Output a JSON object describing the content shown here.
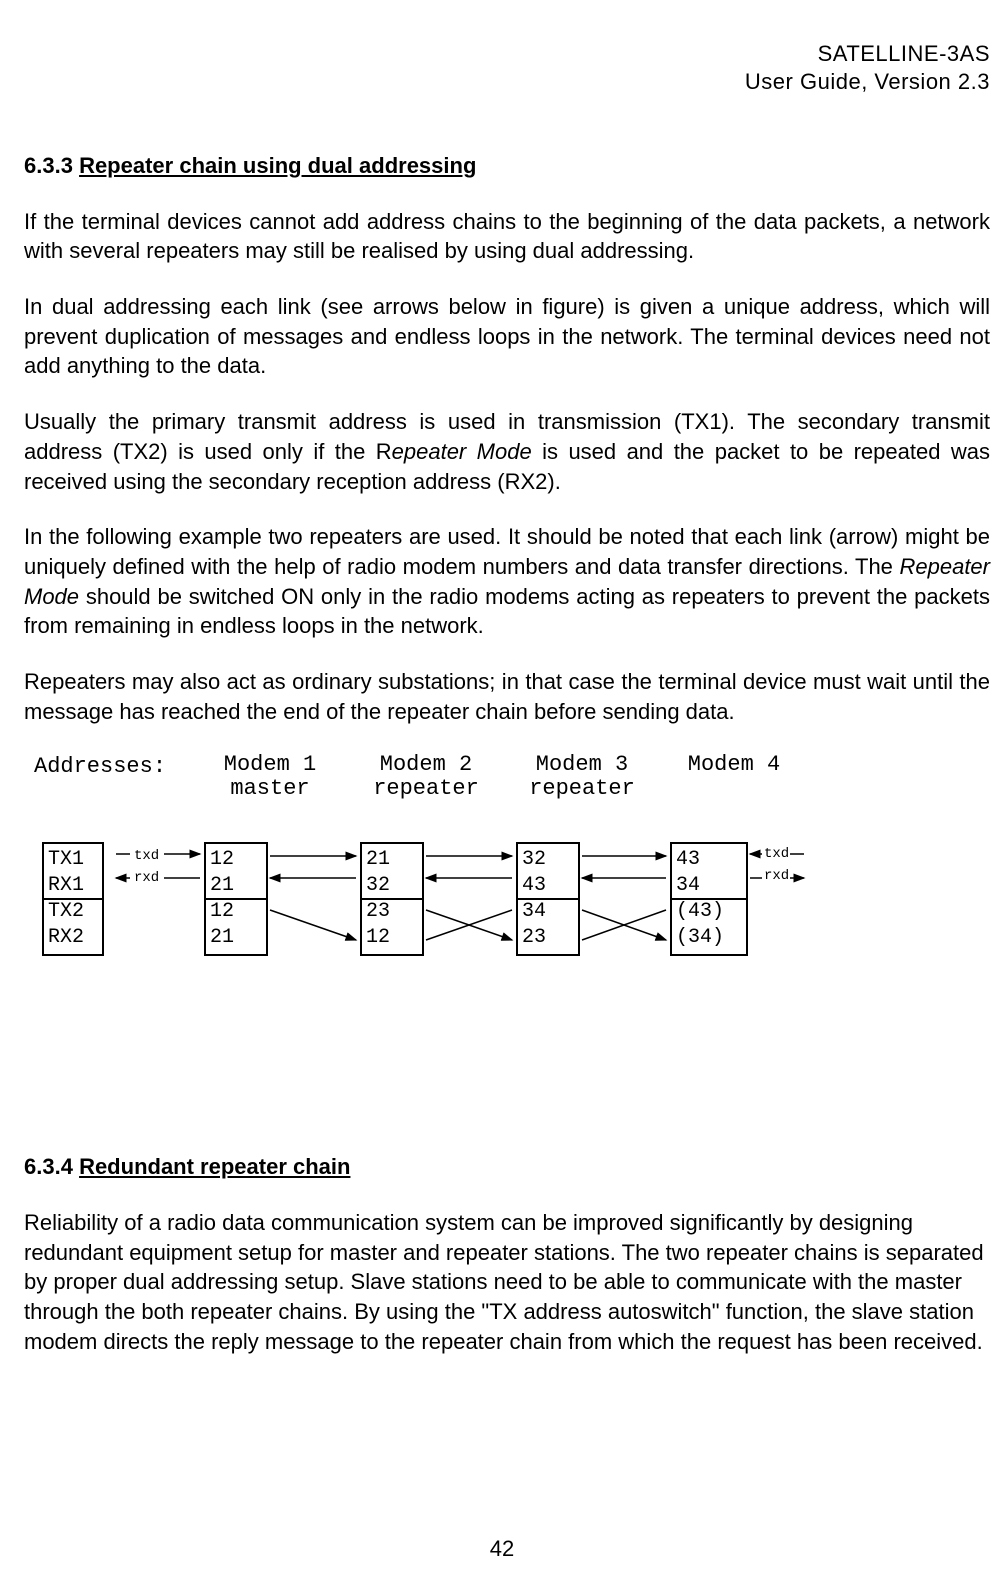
{
  "header": {
    "line1": "SATELLINE-3AS",
    "line2": "User Guide, Version 2.3"
  },
  "sections": [
    {
      "number": "6.3.3",
      "title": "Repeater chain using dual addressing",
      "paragraphs": [
        {
          "type": "plain",
          "text": "If the terminal devices cannot add address chains to the beginning of the data packets, a network with several repeaters may still be realised by using dual addressing."
        },
        {
          "type": "plain",
          "text": "In dual addressing each link (see arrows below in figure) is given a unique address, which will prevent duplication of messages and endless loops in the network. The terminal devices need not add anything to the data."
        },
        {
          "type": "repeater1",
          "pre": "Usually the primary transmit address is used in transmission (TX1). The secondary transmit address (TX2) is used only if the R",
          "em": "epeater Mode",
          "post": " is used and the packet to be repeated was received using the secondary reception address (RX2)."
        },
        {
          "type": "repeater2",
          "pre": "In the following example two repeaters are used. It should be noted that each link (arrow) might be uniquely defined with the help of radio modem numbers and data transfer directions. The ",
          "em": "Repeater Mode",
          "post": " should be switched ON only in the radio modems acting as repeaters to prevent the packets from remaining in endless loops in the network."
        },
        {
          "type": "plain",
          "text": "Repeaters may also act as ordinary substations; in that case the terminal device must wait until the message has reached the end of the repeater chain before sending data."
        }
      ]
    },
    {
      "number": "6.3.4",
      "title": "Redundant repeater chain",
      "paragraphs": [
        {
          "type": "plain",
          "text": "Reliability of a radio data communication system can be improved significantly by designing redundant equipment setup for master and repeater stations. The two repeater chains is separated by proper dual addressing setup. Slave stations need to be able to communicate with the master through the both repeater chains. By using the \"TX address autoswitch\" function, the slave station modem directs the reply message to the repeater chain from which the request has been received."
        }
      ]
    }
  ],
  "diagram": {
    "addresses_label": "Addresses:",
    "modems": [
      {
        "title": "Modem 1",
        "sub": "master"
      },
      {
        "title": "Modem 2",
        "sub": "repeater"
      },
      {
        "title": "Modem 3",
        "sub": "repeater"
      },
      {
        "title": "Modem 4",
        "sub": ""
      }
    ],
    "left_box": {
      "r1": "TX1",
      "r2": "RX1",
      "r3": "TX2",
      "r4": "RX2"
    },
    "box1": {
      "r1": "12",
      "r2": "21",
      "r3": "12",
      "r4": "21"
    },
    "box2": {
      "r1": "21",
      "r2": "32",
      "r3": "23",
      "r4": "12"
    },
    "box3": {
      "r1": "32",
      "r2": "43",
      "r3": "34",
      "r4": "23"
    },
    "box4": {
      "r1": "43",
      "r2": "34",
      "r3": "(43)",
      "r4": "(34)"
    },
    "txd": "txd",
    "rxd": "rxd"
  },
  "page_number": "42"
}
